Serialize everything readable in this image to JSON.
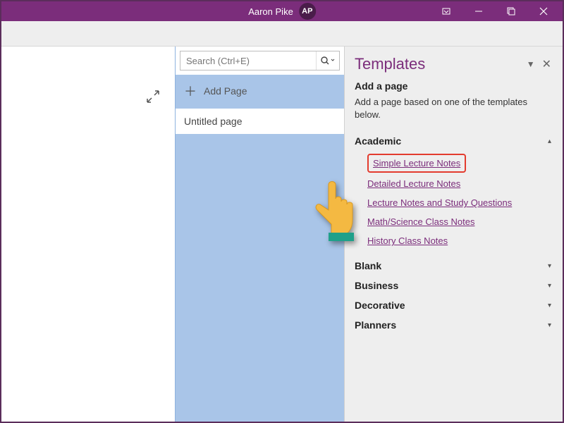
{
  "titlebar": {
    "user_name": "Aaron Pike",
    "user_initials": "AP"
  },
  "search": {
    "placeholder": "Search (Ctrl+E)"
  },
  "pagelist": {
    "add_page_label": "Add Page",
    "pages": [
      "Untitled page"
    ]
  },
  "templates": {
    "title": "Templates",
    "add_label": "Add a page",
    "add_desc": "Add a page based on one of the templates below.",
    "categories": [
      {
        "name": "Academic",
        "expanded": true,
        "items": [
          "Simple Lecture Notes",
          "Detailed Lecture Notes",
          "Lecture Notes and Study Questions",
          "Math/Science Class Notes",
          "History Class Notes"
        ]
      },
      {
        "name": "Blank",
        "expanded": false
      },
      {
        "name": "Business",
        "expanded": false
      },
      {
        "name": "Decorative",
        "expanded": false
      },
      {
        "name": "Planners",
        "expanded": false
      }
    ]
  }
}
